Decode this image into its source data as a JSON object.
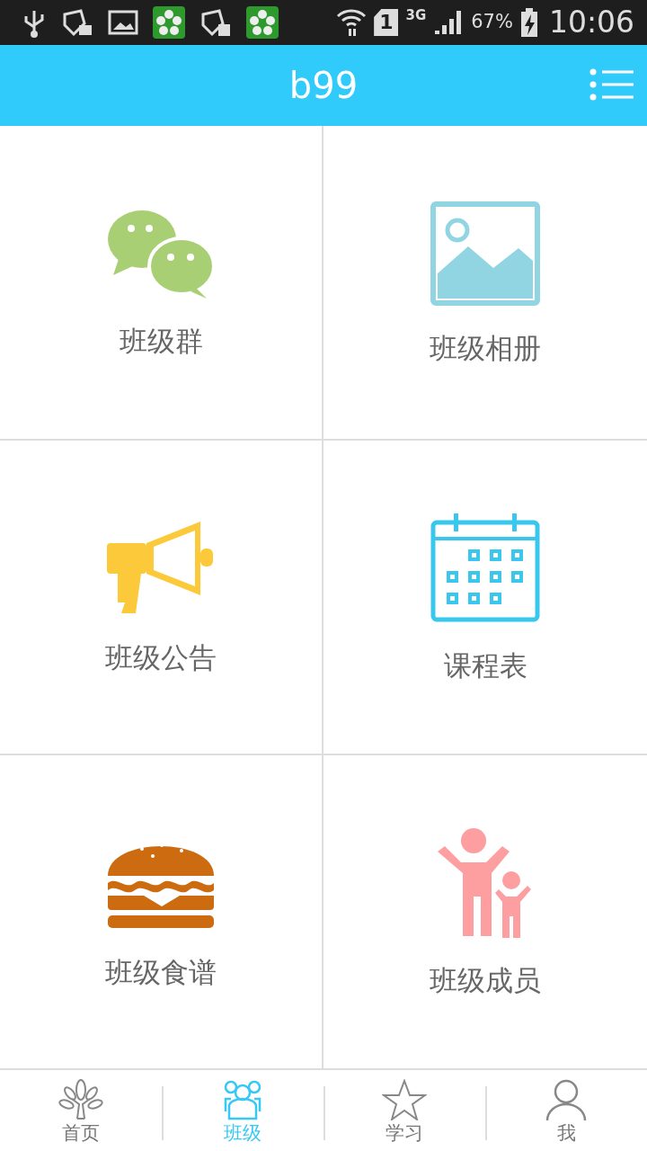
{
  "status_bar": {
    "sim": "1",
    "network": "3G",
    "battery": "67%",
    "time": "10:06"
  },
  "header": {
    "title": "b99"
  },
  "tiles": [
    {
      "kind": "chat",
      "label": "班级群"
    },
    {
      "kind": "album",
      "label": "班级相册"
    },
    {
      "kind": "megaphone",
      "label": "班级公告"
    },
    {
      "kind": "calendar",
      "label": "课程表"
    },
    {
      "kind": "burger",
      "label": "班级食谱"
    },
    {
      "kind": "family",
      "label": "班级成员"
    }
  ],
  "tabs": [
    {
      "kind": "tree",
      "label": "首页",
      "selected": false
    },
    {
      "kind": "group",
      "label": "班级",
      "selected": true
    },
    {
      "kind": "star",
      "label": "学习",
      "selected": false
    },
    {
      "kind": "person",
      "label": "我",
      "selected": false
    }
  ]
}
